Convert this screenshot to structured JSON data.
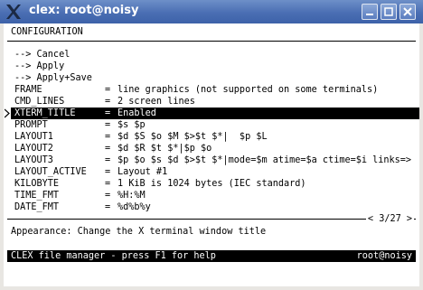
{
  "window": {
    "title": "clex: root@noisy"
  },
  "screen": {
    "header": "CONFIGURATION",
    "commands": [
      {
        "label": "--> Cancel"
      },
      {
        "label": "--> Apply"
      },
      {
        "label": "--> Apply+Save"
      }
    ],
    "settings": [
      {
        "name": "FRAME",
        "value": "line graphics (not supported on some terminals)"
      },
      {
        "name": "CMD_LINES",
        "value": "2 screen lines"
      },
      {
        "name": "XTERM_TITLE",
        "value": "Enabled",
        "selected": true
      },
      {
        "name": "PROMPT",
        "value": "$s $p"
      },
      {
        "name": "LAYOUT1",
        "value": "$d $S $o $M $>$t $*|  $p $L"
      },
      {
        "name": "LAYOUT2",
        "value": "$d $R $t $*|$p $o"
      },
      {
        "name": "LAYOUT3",
        "value": "$p $o $s $d $>$t $*|mode=$m atime=$a ctime=$i links=>"
      },
      {
        "name": "LAYOUT_ACTIVE",
        "value": "Layout #1"
      },
      {
        "name": "KILOBYTE",
        "value": "1 KiB is 1024 bytes (IEC standard)"
      },
      {
        "name": "TIME_FMT",
        "value": "%H:%M"
      },
      {
        "name": "DATE_FMT",
        "value": "%d%b%y"
      }
    ],
    "equals": "=",
    "pager": "< 3/27 >",
    "description": "Appearance: Change the X terminal window title",
    "status_left": "CLEX file manager - press F1 for help",
    "status_right": "root@noisy"
  }
}
